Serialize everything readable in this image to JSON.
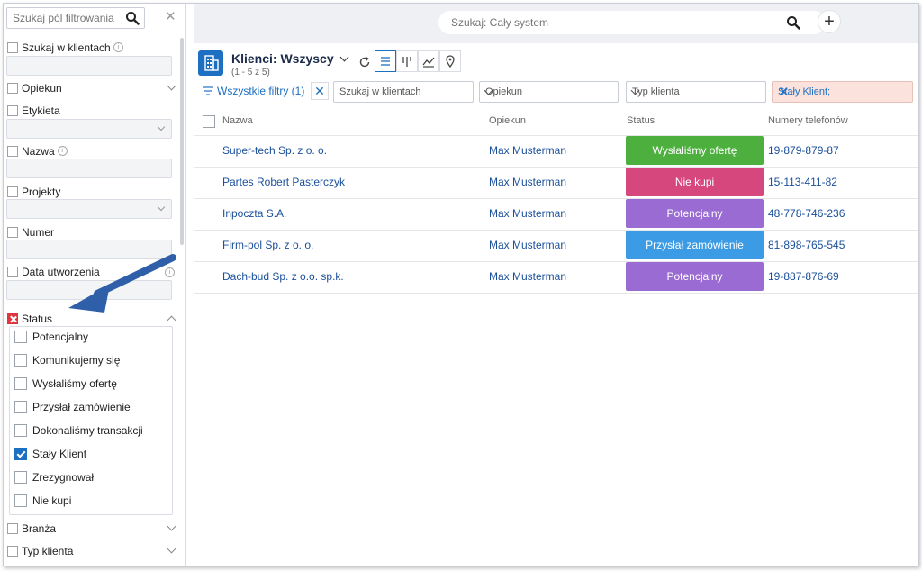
{
  "sidebar": {
    "search_placeholder": "Szukaj pól filtrowania",
    "fields": [
      {
        "label": "Szukaj w klientach",
        "info": true
      },
      {
        "label": "Opiekun"
      },
      {
        "label": "Etykieta"
      },
      {
        "label": "Nazwa",
        "info": true
      },
      {
        "label": "Projekty"
      },
      {
        "label": "Numer"
      },
      {
        "label": "Data utworzenia",
        "info": true
      },
      {
        "label": "Status"
      },
      {
        "label": "Branża"
      },
      {
        "label": "Typ klienta"
      }
    ],
    "status_options": [
      {
        "label": "Potencjalny",
        "checked": false
      },
      {
        "label": "Komunikujemy się",
        "checked": false
      },
      {
        "label": "Wysłaliśmy ofertę",
        "checked": false
      },
      {
        "label": "Przysłał zamówienie",
        "checked": false
      },
      {
        "label": "Dokonaliśmy transakcji",
        "checked": false
      },
      {
        "label": "Stały Klient",
        "checked": true
      },
      {
        "label": "Zrezygnował",
        "checked": false
      },
      {
        "label": "Nie kupi",
        "checked": false
      }
    ]
  },
  "topbar": {
    "search_placeholder": "Szukaj: Cały system"
  },
  "header": {
    "title": "Klienci: Wszyscy",
    "subtitle": "(1 - 5 z 5)"
  },
  "filters": {
    "all_filters": "Wszystkie filtry (1)",
    "search_clients": "Szukaj w klientach",
    "owner": "Opiekun",
    "client_type": "Typ klienta",
    "status_value": "Stały Klient;"
  },
  "table": {
    "columns": [
      "Nazwa",
      "Opiekun",
      "Status",
      "Numery telefonów"
    ],
    "rows": [
      {
        "name": "Super-tech Sp. z o. o.",
        "owner": "Max Musterman",
        "status": "Wysłaliśmy ofertę",
        "phone": "19-879-879-87"
      },
      {
        "name": "Partes Robert Pasterczyk",
        "owner": "Max Musterman",
        "status": "Nie kupi",
        "phone": "15-113-411-82"
      },
      {
        "name": "Inpoczta S.A.",
        "owner": "Max Musterman",
        "status": "Potencjalny",
        "phone": "48-778-746-236"
      },
      {
        "name": "Firm-pol Sp. z o. o.",
        "owner": "Max Musterman",
        "status": "Przysłał zamówienie",
        "phone": "81-898-765-545"
      },
      {
        "name": "Dach-bud Sp. z o.o. sp.k.",
        "owner": "Max Musterman",
        "status": "Potencjalny",
        "phone": "19-887-876-69"
      }
    ]
  },
  "colors": {
    "accent": "#1d6fc1",
    "status_offer": "#4caf3e",
    "status_wont_buy": "#d6477e",
    "status_potential": "#9a6bd2",
    "status_order": "#3b9be5",
    "arrow": "#2e5fa8",
    "active_filter_bg": "#fbe2dc"
  }
}
